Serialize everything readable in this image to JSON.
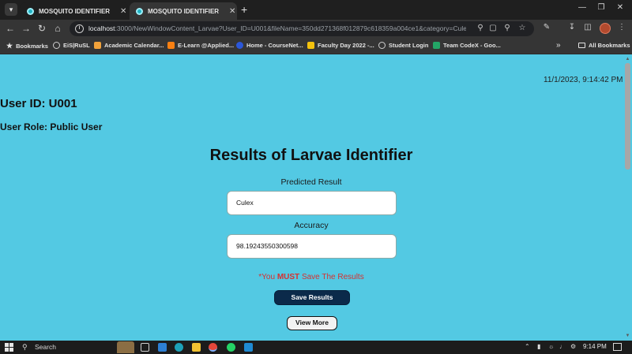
{
  "browser": {
    "tabs": [
      {
        "title": "MOSQUITO IDENTIFIER",
        "active": false
      },
      {
        "title": "MOSQUITO IDENTIFIER",
        "active": true
      }
    ],
    "new_tab": "+",
    "url_host": "localhost",
    "url_rest": ":3000/NewWindowContent_Larvae?User_ID=U001&fileName=350dd271368f012879c618359a004ce1&category=Culex&pro..."
  },
  "bookmarks": [
    {
      "label": "Bookmarks",
      "icon": "star-icon",
      "color": "#e3e3e3"
    },
    {
      "label": "EiS|RuSL",
      "icon": "globe-icon",
      "color": "#cfcfcf"
    },
    {
      "label": "Academic Calendar...",
      "icon": "calendar-icon",
      "color": "#f2a23a"
    },
    {
      "label": "E-Learn @Applied...",
      "icon": "moodle-icon",
      "color": "#f98012"
    },
    {
      "label": "Home - CourseNet...",
      "icon": "coursenet-icon",
      "color": "#2b57d9"
    },
    {
      "label": "Faculty Day 2022 -...",
      "icon": "drive-icon",
      "color": "#f4c20d"
    },
    {
      "label": "Student Login",
      "icon": "globe-icon",
      "color": "#cfcfcf"
    },
    {
      "label": "Team CodeX - Goo...",
      "icon": "sheets-icon",
      "color": "#23a566"
    }
  ],
  "all_bookmarks": "All Bookmarks",
  "page": {
    "datetime": "11/1/2023, 9:14:42 PM",
    "user_id_label": "User ID: U001",
    "user_role_label": "User Role: Public User",
    "heading": "Results of Larvae Identifier",
    "predicted_label": "Predicted Result",
    "predicted_value": "Culex",
    "accuracy_label": "Accuracy",
    "accuracy_value": "98.19243550300598",
    "warning_prefix": "*You ",
    "warning_strong": "MUST",
    "warning_suffix": " Save The Results",
    "save_button": "Save Results",
    "view_button": "View More"
  },
  "taskbar": {
    "search_placeholder": "Search",
    "clock": "9:14 PM"
  },
  "colors": {
    "page_bg": "#53c9e3",
    "warning": "#d63131",
    "save_button_bg": "#0b2a4a"
  }
}
